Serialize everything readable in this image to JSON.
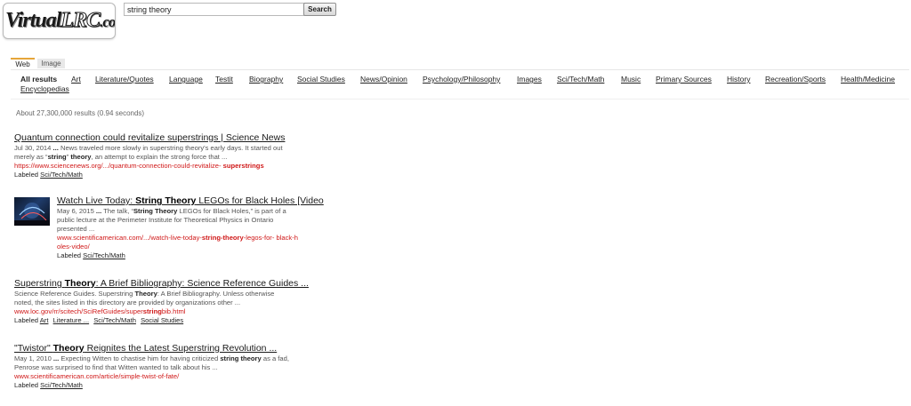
{
  "logo": {
    "part1": "Virtual",
    "part2": "LRC",
    "part3": ".com"
  },
  "search": {
    "value": "string theory",
    "button_label": "Search"
  },
  "tabs": [
    {
      "label": "Web"
    },
    {
      "label": "Image"
    }
  ],
  "categories": [
    "All results",
    "Art",
    "Literature/Quotes",
    "Language",
    "Testit",
    "Biography",
    "Social Studies",
    "News/Opinion",
    "Psychology/Philosophy",
    "Images",
    "Sci/Tech/Math",
    "Music",
    "Primary Sources",
    "History",
    "Recreation/Sports",
    "Health/Medicine",
    "Encyclopedias"
  ],
  "stats": "About 27,300,000 results (0.94 seconds)",
  "results": [
    {
      "title": "Quantum connection could revitalize superstrings | Science News",
      "snippet": "Jul 30, 2014 <b>...</b> News traveled more slowly in superstring theory's early days. It started out<br>merely as “<b>string</b>” <b>theory</b>, an attempt to explain the strong force that ...",
      "url": "https://www.sciencenews.org/.../quantum-connection-could-revitalize- <b>superstrings</b>",
      "labels": [
        "Sci/Tech/Math"
      ]
    },
    {
      "title": "Watch Live Today: <b>String Theory</b> LEGOs for Black Holes [Video",
      "snippet": "May 6, 2015 <b>...</b> The talk, “<b>String Theory</b> LEGOs for Black Holes,” is part of a<br>public lecture at the Perimeter Institute for Theoretical Physics in Ontario<br>presented ...",
      "url": "www.scientificamerican.com/.../watch-live-today-<b>string-theory</b>-legos-for- black-h<br>oles-video/",
      "labels": [
        "Sci/Tech/Math"
      ]
    },
    {
      "title": "Superstring <b>Theory</b>: A Brief Bibliography: Science Reference Guides ...",
      "snippet": "Science Reference Guides. Superstring <b>Theory</b>: A Brief Bibliography. Unless otherwise<br>noted, the sites listed in this directory are provided by organizations other ...",
      "url": "www.loc.gov/rr/scitech/SciRefGuides/super<b>string</b>bib.html",
      "labels": [
        "Art",
        "Literature ...",
        "Sci/Tech/Math",
        "Social Studies"
      ]
    },
    {
      "title": "\"Twistor\" <b>Theory</b> Reignites the Latest Superstring Revolution ...",
      "snippet": "May 1, 2010 <b>...</b> Expecting Witten to chastise him for having criticized <b>string theory</b> as a fad,<br>Penrose was surprised to find that Witten wanted to talk about his ...",
      "url": "www.scientificamerican.com/article/simple-twist-of-fate/",
      "labels": [
        "Sci/Tech/Math"
      ]
    }
  ],
  "labeled_prefix": "Labeled"
}
